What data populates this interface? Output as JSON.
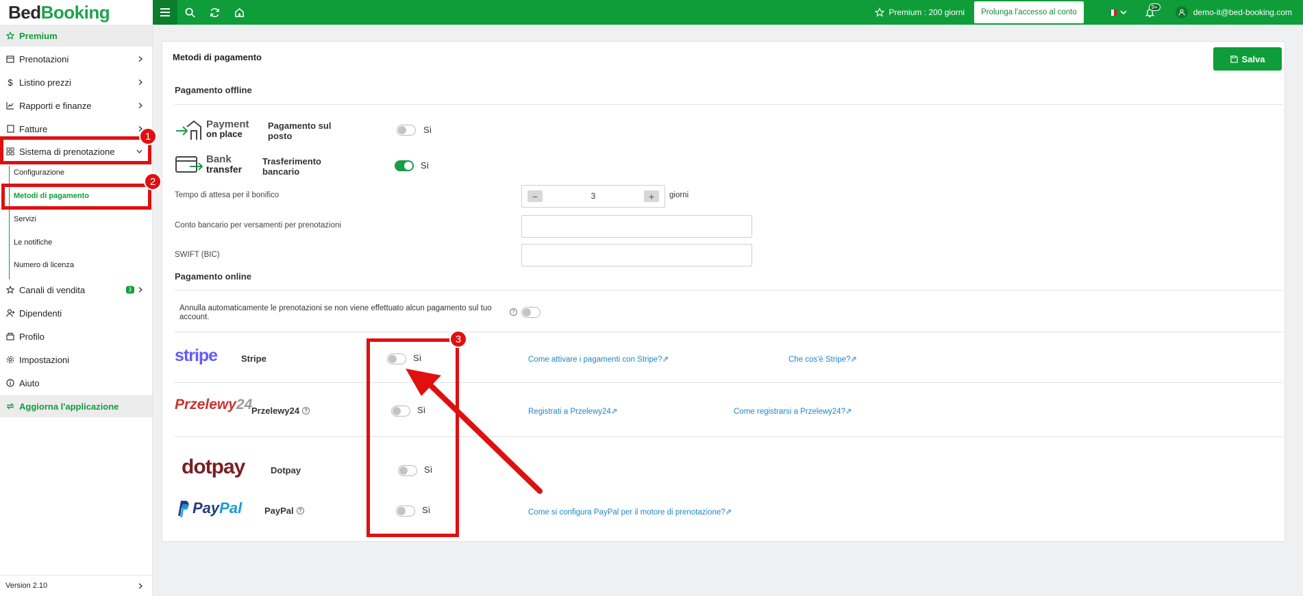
{
  "brand": {
    "bed": "Bed",
    "booking": "Booking"
  },
  "topbar": {
    "premium": "Premium : 200 giorni",
    "extend": "Prolunga l'accesso al conto",
    "notif_count": "9+",
    "user_email": "demo-it@bed-booking.com"
  },
  "sidebar": {
    "premium": "Premium",
    "items": [
      {
        "label": "Prenotazioni"
      },
      {
        "label": "Listino prezzi"
      },
      {
        "label": "Rapporti e finanze"
      },
      {
        "label": "Fatture"
      },
      {
        "label": "Sistema di prenotazione"
      }
    ],
    "sub": [
      {
        "label": "Configurazione"
      },
      {
        "label": "Metodi di pagamento"
      },
      {
        "label": "Servizi"
      },
      {
        "label": "Le notifiche"
      },
      {
        "label": "Numero di licenza"
      }
    ],
    "items2": [
      {
        "label": "Canali di vendita",
        "badge": "3"
      },
      {
        "label": "Dipendenti"
      },
      {
        "label": "Profilo"
      },
      {
        "label": "Impostazioni"
      },
      {
        "label": "Aiuto"
      }
    ],
    "update": "Aggiorna l'applicazione",
    "version": "Version 2.10"
  },
  "main": {
    "title": "Metodi di pagamento",
    "save": "Salva",
    "offline_title": "Pagamento offline",
    "online_title": "Pagamento online",
    "yes": "Sì",
    "payment_on_place": {
      "logo_top": "Payment",
      "logo_bottom": "on place",
      "name1": "Pagamento sul",
      "name2": "posto"
    },
    "bank_transfer": {
      "logo_top": "Bank",
      "logo_bottom": "transfer",
      "name1": "Trasferimento",
      "name2": "bancario"
    },
    "wait_label": "Tempo di attesa per il bonifico",
    "wait_value": "3",
    "wait_unit": "giorni",
    "bank_account_label": "Conto bancario per versamenti per prenotazioni",
    "swift_label": "SWIFT (BIC)",
    "auto_cancel": "Annulla automaticamente le prenotazioni se non viene effettuato alcun pagamento sul tuo account.",
    "stripe": {
      "logo": "stripe",
      "name": "Stripe",
      "link1": "Come attivare i pagamenti con Stripe?",
      "link2": "Che cos'è Stripe?"
    },
    "przelewy": {
      "logo": "Przelewy",
      "logo_num": "24",
      "name": "Przelewy24",
      "link1": "Registrati a Przelewy24",
      "link2": "Come registrarsi a Przelewy24?"
    },
    "dotpay": {
      "logo": "dotpay",
      "name": "Dotpay"
    },
    "paypal": {
      "logo_pay": "Pay",
      "logo_pal": "Pal",
      "name": "PayPal",
      "link1": "Come si configura PayPal per il motore di prenotazione?"
    }
  },
  "annotations": {
    "n1": "1",
    "n2": "2",
    "n3": "3"
  },
  "colors": {
    "brand_green": "#0f9d3a",
    "annotation_red": "#e01010",
    "link_blue": "#1d87c7"
  }
}
